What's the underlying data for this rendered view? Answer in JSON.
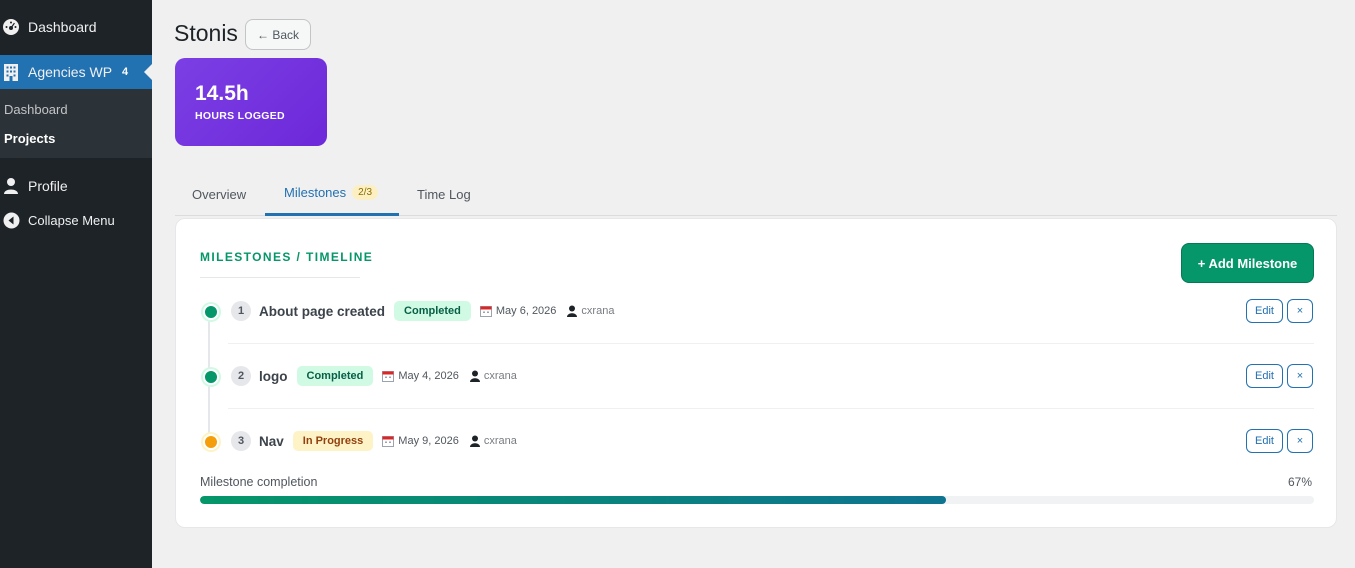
{
  "sidebar": {
    "dashboard": "Dashboard",
    "agencies": "Agencies WP",
    "agencies_badge": "4",
    "sub_dashboard": "Dashboard",
    "sub_projects": "Projects",
    "profile": "Profile",
    "collapse": "Collapse Menu"
  },
  "header": {
    "title": "Stonis",
    "back_label": "← Back"
  },
  "stat": {
    "value": "14.5h",
    "label": "HOURS LOGGED"
  },
  "tabs": [
    {
      "label": "Overview"
    },
    {
      "label": "Milestones",
      "count": "2/3"
    },
    {
      "label": "Time Log"
    }
  ],
  "panel": {
    "title": "MILESTONES / TIMELINE",
    "add_label": "+ Add Milestone"
  },
  "milestones": [
    {
      "num": "1",
      "name": "About page created",
      "status": "Completed",
      "date": "May 6, 2026",
      "user": "cxrana",
      "edit": "Edit",
      "remove": "×"
    },
    {
      "num": "2",
      "name": "logo",
      "status": "Completed",
      "date": "May 4, 2026",
      "user": "cxrana",
      "edit": "Edit",
      "remove": "×"
    },
    {
      "num": "3",
      "name": "Nav",
      "status": "In Progress",
      "date": "May 9, 2026",
      "user": "cxrana",
      "edit": "Edit",
      "remove": "×"
    }
  ],
  "progress": {
    "label": "Milestone completion",
    "percent_text": "67%",
    "value": 0.67
  },
  "colors": {
    "sidebar_bg": "#1d2327",
    "active_menu": "#2271b1",
    "stat_card": "#6d28d9",
    "accent_green": "#059669",
    "in_progress": "#f59e0b"
  }
}
